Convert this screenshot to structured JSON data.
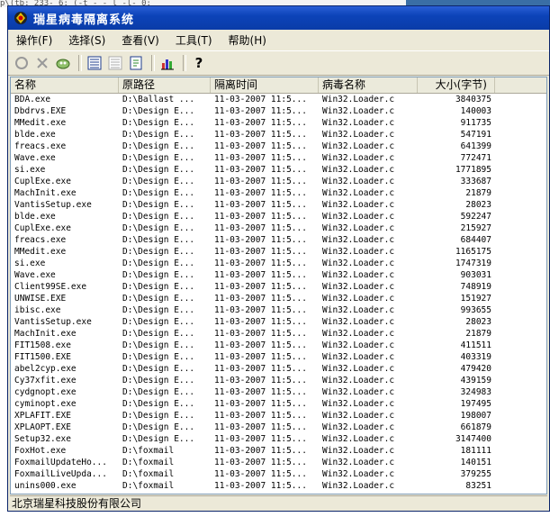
{
  "window": {
    "title": "瑞星病毒隔离系统"
  },
  "background": {
    "path_text": "p\\(tb: 233- 6: (-t - - l -l- 0: "
  },
  "menu": [
    {
      "label": "操作(F)"
    },
    {
      "label": "选择(S)"
    },
    {
      "label": "查看(V)"
    },
    {
      "label": "工具(T)"
    },
    {
      "label": "帮助(H)"
    }
  ],
  "toolbar": {
    "icons": [
      "refresh-icon",
      "delete-icon",
      "restore-icon",
      "details-view-icon",
      "list-view-icon",
      "log-icon",
      "statistics-icon",
      "help-icon"
    ]
  },
  "columns": {
    "name": "名称",
    "path": "原路径",
    "time": "隔离时间",
    "virus": "病毒名称",
    "size": "大小(字节)"
  },
  "rows": [
    {
      "name": "BDA.exe",
      "path": "D:\\Ballast ...",
      "time": "11-03-2007 11:5...",
      "virus": "Win32.Loader.c",
      "size": "3840375"
    },
    {
      "name": "Dbdrvs.EXE",
      "path": "D:\\Design E...",
      "time": "11-03-2007 11:5...",
      "virus": "Win32.Loader.c",
      "size": "140003"
    },
    {
      "name": "MMedit.exe",
      "path": "D:\\Design E...",
      "time": "11-03-2007 11:5...",
      "virus": "Win32.Loader.c",
      "size": "911735"
    },
    {
      "name": "blde.exe",
      "path": "D:\\Design E...",
      "time": "11-03-2007 11:5...",
      "virus": "Win32.Loader.c",
      "size": "547191"
    },
    {
      "name": "freacs.exe",
      "path": "D:\\Design E...",
      "time": "11-03-2007 11:5...",
      "virus": "Win32.Loader.c",
      "size": "641399"
    },
    {
      "name": "Wave.exe",
      "path": "D:\\Design E...",
      "time": "11-03-2007 11:5...",
      "virus": "Win32.Loader.c",
      "size": "772471"
    },
    {
      "name": "si.exe",
      "path": "D:\\Design E...",
      "time": "11-03-2007 11:5...",
      "virus": "Win32.Loader.c",
      "size": "1771895"
    },
    {
      "name": "CuplExe.exe",
      "path": "D:\\Design E...",
      "time": "11-03-2007 11:5...",
      "virus": "Win32.Loader.c",
      "size": "333687"
    },
    {
      "name": "MachInit.exe",
      "path": "D:\\Design E...",
      "time": "11-03-2007 11:5...",
      "virus": "Win32.Loader.c",
      "size": "21879"
    },
    {
      "name": "VantisSetup.exe",
      "path": "D:\\Design E...",
      "time": "11-03-2007 11:5...",
      "virus": "Win32.Loader.c",
      "size": "28023"
    },
    {
      "name": "blde.exe",
      "path": "D:\\Design E...",
      "time": "11-03-2007 11:5...",
      "virus": "Win32.Loader.c",
      "size": "592247"
    },
    {
      "name": "CuplExe.exe",
      "path": "D:\\Design E...",
      "time": "11-03-2007 11:5...",
      "virus": "Win32.Loader.c",
      "size": "215927"
    },
    {
      "name": "freacs.exe",
      "path": "D:\\Design E...",
      "time": "11-03-2007 11:5...",
      "virus": "Win32.Loader.c",
      "size": "684407"
    },
    {
      "name": "MMedit.exe",
      "path": "D:\\Design E...",
      "time": "11-03-2007 11:5...",
      "virus": "Win32.Loader.c",
      "size": "1165175"
    },
    {
      "name": "si.exe",
      "path": "D:\\Design E...",
      "time": "11-03-2007 11:5...",
      "virus": "Win32.Loader.c",
      "size": "1747319"
    },
    {
      "name": "Wave.exe",
      "path": "D:\\Design E...",
      "time": "11-03-2007 11:5...",
      "virus": "Win32.Loader.c",
      "size": "903031"
    },
    {
      "name": "Client99SE.exe",
      "path": "D:\\Design E...",
      "time": "11-03-2007 11:5...",
      "virus": "Win32.Loader.c",
      "size": "748919"
    },
    {
      "name": "UNWISE.EXE",
      "path": "D:\\Design E...",
      "time": "11-03-2007 11:5...",
      "virus": "Win32.Loader.c",
      "size": "151927"
    },
    {
      "name": "ibisc.exe",
      "path": "D:\\Design E...",
      "time": "11-03-2007 11:5...",
      "virus": "Win32.Loader.c",
      "size": "993655"
    },
    {
      "name": "VantisSetup.exe",
      "path": "D:\\Design E...",
      "time": "11-03-2007 11:5...",
      "virus": "Win32.Loader.c",
      "size": "28023"
    },
    {
      "name": "MachInit.exe",
      "path": "D:\\Design E...",
      "time": "11-03-2007 11:5...",
      "virus": "Win32.Loader.c",
      "size": "21879"
    },
    {
      "name": "FIT1508.exe",
      "path": "D:\\Design E...",
      "time": "11-03-2007 11:5...",
      "virus": "Win32.Loader.c",
      "size": "411511"
    },
    {
      "name": "FIT1500.EXE",
      "path": "D:\\Design E...",
      "time": "11-03-2007 11:5...",
      "virus": "Win32.Loader.c",
      "size": "403319"
    },
    {
      "name": "abel2cyp.exe",
      "path": "D:\\Design E...",
      "time": "11-03-2007 11:5...",
      "virus": "Win32.Loader.c",
      "size": "479420"
    },
    {
      "name": "Cy37xfit.exe",
      "path": "D:\\Design E...",
      "time": "11-03-2007 11:5...",
      "virus": "Win32.Loader.c",
      "size": "439159"
    },
    {
      "name": "cydgnopt.exe",
      "path": "D:\\Design E...",
      "time": "11-03-2007 11:5...",
      "virus": "Win32.Loader.c",
      "size": "324983"
    },
    {
      "name": "cyminopt.exe",
      "path": "D:\\Design E...",
      "time": "11-03-2007 11:5...",
      "virus": "Win32.Loader.c",
      "size": "197495"
    },
    {
      "name": "XPLAFIT.EXE",
      "path": "D:\\Design E...",
      "time": "11-03-2007 11:5...",
      "virus": "Win32.Loader.c",
      "size": "198007"
    },
    {
      "name": "XPLAOPT.EXE",
      "path": "D:\\Design E...",
      "time": "11-03-2007 11:5...",
      "virus": "Win32.Loader.c",
      "size": "661879"
    },
    {
      "name": "Setup32.exe",
      "path": "D:\\Design E...",
      "time": "11-03-2007 11:5...",
      "virus": "Win32.Loader.c",
      "size": "3147400"
    },
    {
      "name": "FoxHot.exe",
      "path": "D:\\foxmail",
      "time": "11-03-2007 11:5...",
      "virus": "Win32.Loader.c",
      "size": "181111"
    },
    {
      "name": "FoxmailUpdateHo...",
      "path": "D:\\foxmail",
      "time": "11-03-2007 11:5...",
      "virus": "Win32.Loader.c",
      "size": "140151"
    },
    {
      "name": "FoxmailLiveUpda...",
      "path": "D:\\foxmail",
      "time": "11-03-2007 11:5...",
      "virus": "Win32.Loader.c",
      "size": "379255"
    },
    {
      "name": "unins000.exe",
      "path": "D:\\foxmail",
      "time": "11-03-2007 11:5...",
      "virus": "Win32.Loader.c",
      "size": "83251"
    }
  ],
  "status": {
    "text": "北京瑞星科技股份有限公司"
  }
}
